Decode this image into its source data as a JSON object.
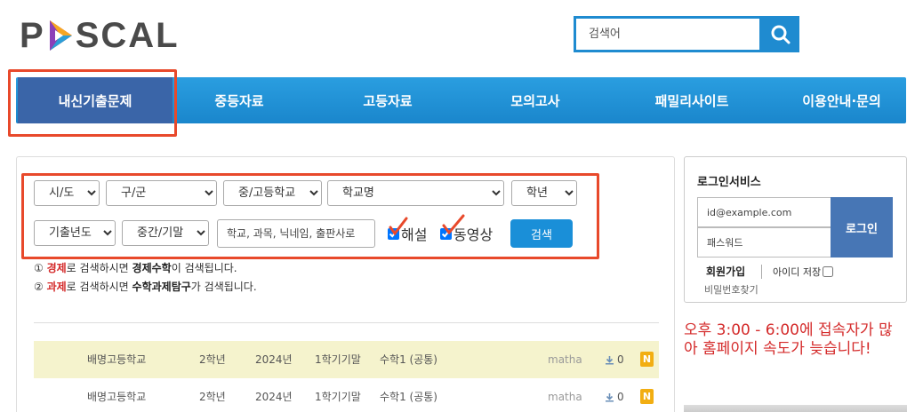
{
  "logo": {
    "left": "P",
    "right": "SCAL"
  },
  "search": {
    "placeholder": "검색어"
  },
  "nav": [
    "내신기출문제",
    "중등자료",
    "고등자료",
    "모의고사",
    "패밀리사이트",
    "이용안내·문의"
  ],
  "filters": {
    "sido": "시/도",
    "gugun": "구/군",
    "school_level": "중/고등학교",
    "school_name": "학교명",
    "grade": "학년",
    "year": "기출년도",
    "exam": "중간/기말",
    "keyword_placeholder": "학교, 과목, 닉네임, 출판사로",
    "check_solution": "해설",
    "check_video": "동영상",
    "search_button": "검색"
  },
  "notes": [
    {
      "prefix": "① ",
      "red": "경제",
      "mid": "로 검색하시면 ",
      "bold": "경제수학",
      "suffix": "이 검색됩니다."
    },
    {
      "prefix": "② ",
      "red": "과제",
      "mid": "로 검색하시면 ",
      "bold": "수학과제탐구",
      "suffix": "가 검색됩니다."
    }
  ],
  "rows": [
    {
      "school": "배명고등학교",
      "grade": "2학년",
      "year": "2024년",
      "term": "1학기기말",
      "subject": "수학1 (공통)",
      "user": "matha",
      "downloads": "0",
      "badge": "N"
    },
    {
      "school": "배명고등학교",
      "grade": "2학년",
      "year": "2024년",
      "term": "1학기기말",
      "subject": "수학1 (공통)",
      "user": "matha",
      "downloads": "0",
      "badge": "N"
    }
  ],
  "login": {
    "title": "로그인서비스",
    "id_placeholder": "id@example.com",
    "pw_placeholder": "패스워드",
    "button": "로그인",
    "join": "회원가입",
    "save_id": "아이디 저장",
    "find_pw": "비밀번호찾기"
  },
  "notice": "오후 3:00 - 6:00에 접속자가 많아 홈페이지 속도가 늦습니다!",
  "colors": {
    "brand_blue": "#1f8bd0",
    "nav_active": "#3a65a8",
    "highlight_red": "#e8492b",
    "notice_red": "#d42a2a",
    "badge": "#f2ae12"
  }
}
